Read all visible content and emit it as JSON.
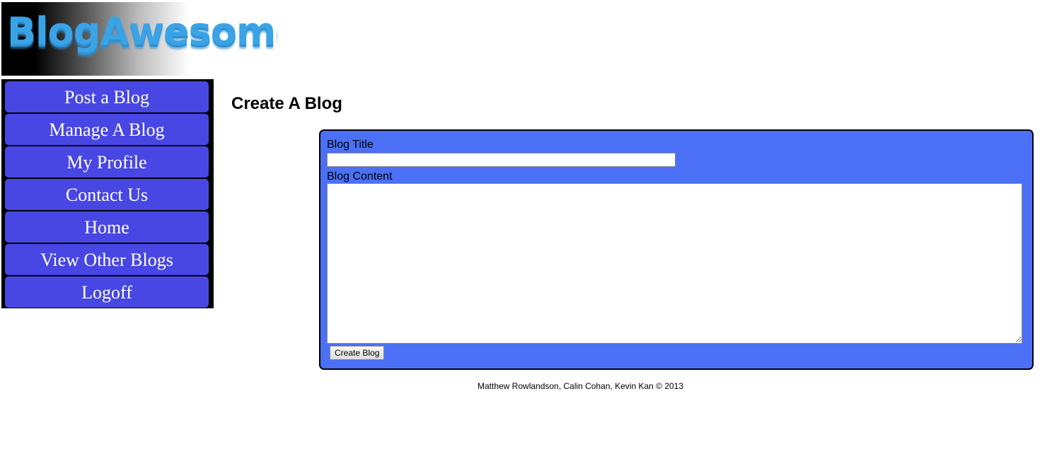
{
  "header": {
    "logo_text": "BlogAwesome!"
  },
  "nav": {
    "items": [
      {
        "label": "Post a Blog"
      },
      {
        "label": "Manage A Blog"
      },
      {
        "label": "My Profile"
      },
      {
        "label": "Contact Us"
      },
      {
        "label": "Home"
      },
      {
        "label": "View Other Blogs"
      },
      {
        "label": "Logoff"
      }
    ]
  },
  "main": {
    "title": "Create A Blog",
    "form": {
      "title_label": "Blog Title",
      "title_value": "",
      "content_label": "Blog Content",
      "content_value": "",
      "submit_label": "Create Blog"
    }
  },
  "footer": {
    "text": "Matthew Rowlandson, Calin Cohan, Kevin Kan © 2013"
  },
  "colors": {
    "nav_button": "#4847e3",
    "form_panel": "#4b70f5",
    "logo_text": "#3aa3e6"
  }
}
